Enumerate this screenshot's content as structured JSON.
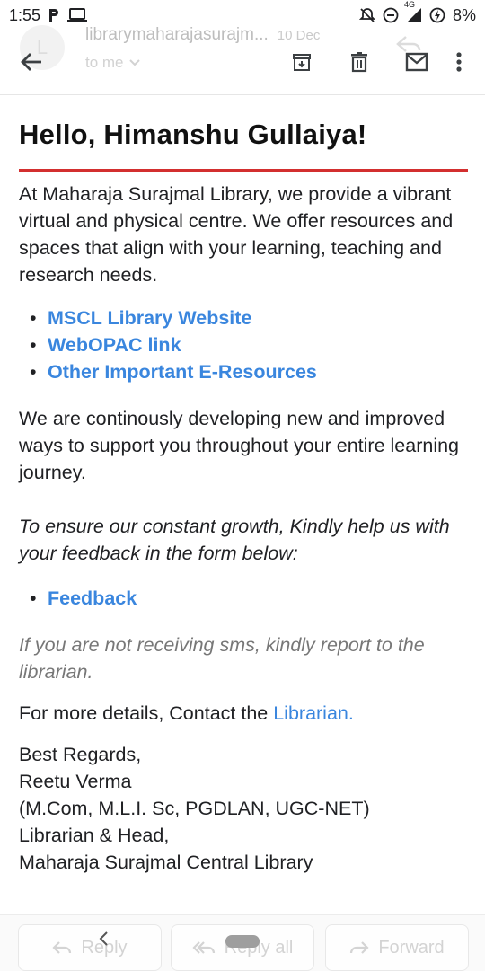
{
  "status_bar": {
    "time": "1:55",
    "network_label": "4G",
    "battery": "8%"
  },
  "app_bar": {
    "sender": "librarymaharajasurajm...",
    "date": "10 Dec",
    "to": "to me",
    "avatar_initial": "L"
  },
  "email": {
    "greeting": "Hello, Himanshu Gullaiya!",
    "intro": "At Maharaja Surajmal Library, we provide a vibrant virtual and physical centre. We offer resources and spaces that align with your learning, teaching and research needs.",
    "links": [
      {
        "label": "MSCL Library Website"
      },
      {
        "label": "WebOPAC link"
      },
      {
        "label": "Other Important E-Resources"
      }
    ],
    "developing": "We are continously developing new and improved ways to support you throughout your entire learning journey.",
    "feedback_request": "To ensure our constant growth, Kindly help us with your feedback in the form below:",
    "feedback_link": "Feedback",
    "sms_note": "If you are not receiving sms, kindly report to the librarian.",
    "contact_prefix": "For more details, Contact the ",
    "contact_link": "Librarian.",
    "signature": [
      "Best Regards,",
      "Reetu Verma",
      "(M.Com, M.L.I. Sc, PGDLAN, UGC-NET)",
      "Librarian & Head,",
      "Maharaja Surajmal Central Library"
    ]
  },
  "bottom_bar": {
    "reply": "Reply",
    "reply_all": "Reply all",
    "forward": "Forward"
  },
  "icons": {
    "back": "arrow-left-icon",
    "archive": "archive-icon",
    "delete": "trash-icon",
    "mark_unread": "mail-icon",
    "more": "more-vert-icon"
  },
  "colors": {
    "accent_red": "#d32f2f",
    "link_blue": "#3a86de"
  }
}
